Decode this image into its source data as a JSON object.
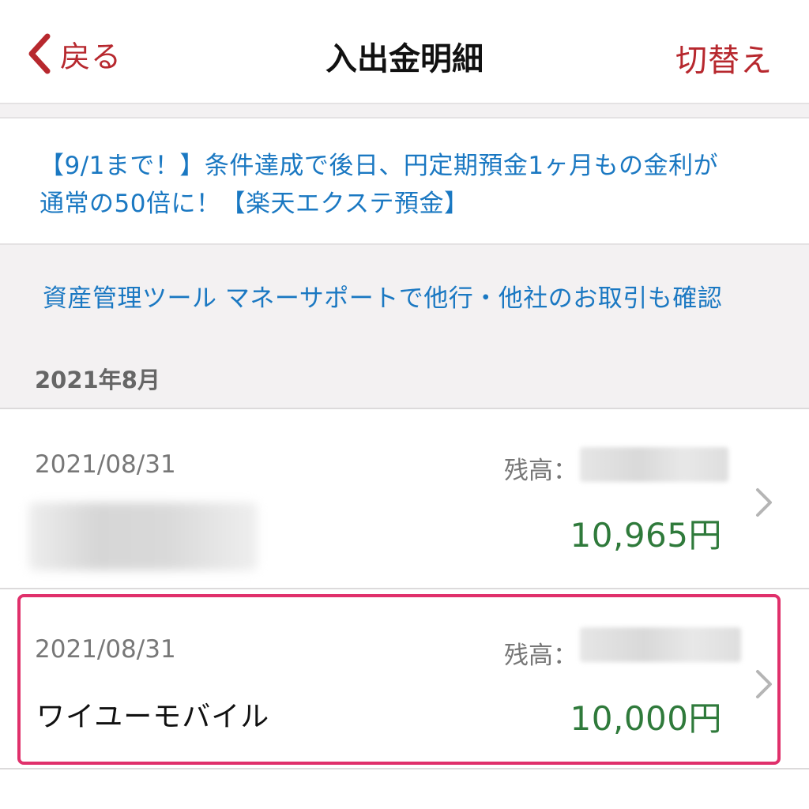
{
  "header": {
    "back_label": "戻る",
    "title": "入出金明細",
    "switch_label": "切替え"
  },
  "promo": {
    "line1": "【9/1まで！】条件達成で後日、円定期預金1ヶ月もの金利が",
    "line2": "通常の50倍に！【楽天エクステ預金】"
  },
  "support": {
    "link_label": "資産管理ツール マネーサポートで他行・他社のお取引も確認",
    "month_heading": "2021年8月"
  },
  "transactions": [
    {
      "date": "2021/08/31",
      "balance_label": "残高：",
      "name": "",
      "amount": "10,965円"
    },
    {
      "date": "2021/08/31",
      "balance_label": "残高：",
      "name": "ワイユーモバイル",
      "amount": "10,000円"
    }
  ],
  "colors": {
    "accent_red": "#b7282e",
    "link_blue": "#1a78c2",
    "amount_green": "#2f7a3b",
    "highlight_pink": "#e0306b"
  },
  "icons": {
    "back": "chevron-left-icon",
    "row_arrow": "chevron-right-icon"
  }
}
